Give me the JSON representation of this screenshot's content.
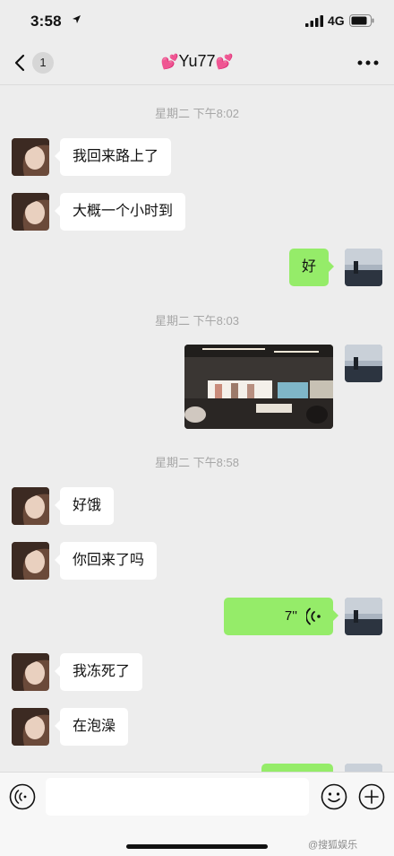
{
  "status": {
    "time": "3:58",
    "network": "4G"
  },
  "nav": {
    "unread": "1",
    "title": "Yu77"
  },
  "timestamps": [
    "星期二 下午8:02",
    "星期二 下午8:03",
    "星期二 下午8:58"
  ],
  "messages": {
    "m1": "我回来路上了",
    "m2": "大概一个小时到",
    "m3": "好",
    "m5": "好饿",
    "m6": "你回来了吗",
    "m7_duration": "7''",
    "m8": "我冻死了",
    "m9": "在泡澡"
  },
  "input": {
    "value": ""
  },
  "watermark": "@搜狐娱乐",
  "colors": {
    "background": "#ededed",
    "outgoing_bubble": "#95ec69",
    "incoming_bubble": "#ffffff",
    "heart": "#e9428f"
  },
  "icons": [
    "location-arrow-icon",
    "signal-icon",
    "battery-icon",
    "back-chevron-icon",
    "more-icon",
    "voice-wave-icon",
    "voice-mode-icon",
    "emoji-icon",
    "plus-icon",
    "heart-icon"
  ]
}
